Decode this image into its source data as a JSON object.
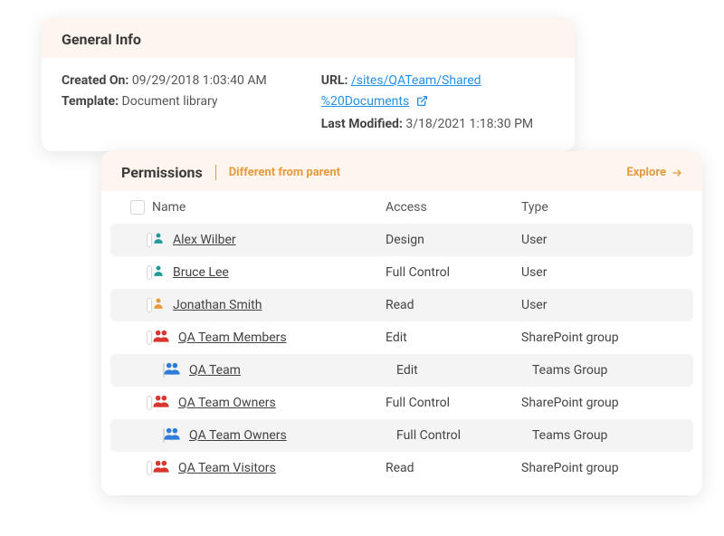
{
  "general": {
    "title": "General Info",
    "createdOnLabel": "Created On:",
    "createdOnValue": "09/29/2018 1:03:40 AM",
    "templateLabel": "Template:",
    "templateValue": "Document library",
    "urlLabel": "URL:",
    "urlLine1": "/sites/QATeam/Shared",
    "urlLine2": "%20Documents",
    "lastModLabel": "Last Modified:",
    "lastModValue": "3/18/2021 1:18:30 PM"
  },
  "permissions": {
    "title": "Permissions",
    "diffParent": "Different from parent",
    "explore": "Explore",
    "columns": {
      "name": "Name",
      "access": "Access",
      "type": "Type"
    },
    "rows": [
      {
        "name": "Alex Wilber",
        "access": "Design",
        "type": "User",
        "icon": "user",
        "color": "#1E9B9B",
        "indent": 1,
        "striped": true
      },
      {
        "name": "Bruce Lee",
        "access": "Full Control",
        "type": "User",
        "icon": "user",
        "color": "#1E9B9B",
        "indent": 1,
        "striped": false
      },
      {
        "name": "Jonathan Smith",
        "access": "Read",
        "type": "User",
        "icon": "user",
        "color": "#E89A3C",
        "indent": 1,
        "striped": true
      },
      {
        "name": "QA Team Members",
        "access": "Edit",
        "type": "SharePoint group",
        "icon": "group",
        "color": "#D9362F",
        "indent": 1,
        "striped": false
      },
      {
        "name": "QA Team",
        "access": "Edit",
        "type": "Teams Group",
        "icon": "group",
        "color": "#2F7BD9",
        "indent": 2,
        "striped": true
      },
      {
        "name": "QA Team Owners",
        "access": "Full Control",
        "type": "SharePoint group",
        "icon": "group",
        "color": "#D9362F",
        "indent": 1,
        "striped": false
      },
      {
        "name": "QA Team Owners",
        "access": "Full Control",
        "type": "Teams Group",
        "icon": "group",
        "color": "#2F7BD9",
        "indent": 2,
        "striped": true
      },
      {
        "name": "QA Team Visitors",
        "access": "Read",
        "type": "SharePoint group",
        "icon": "group",
        "color": "#D9362F",
        "indent": 1,
        "striped": false
      }
    ]
  }
}
